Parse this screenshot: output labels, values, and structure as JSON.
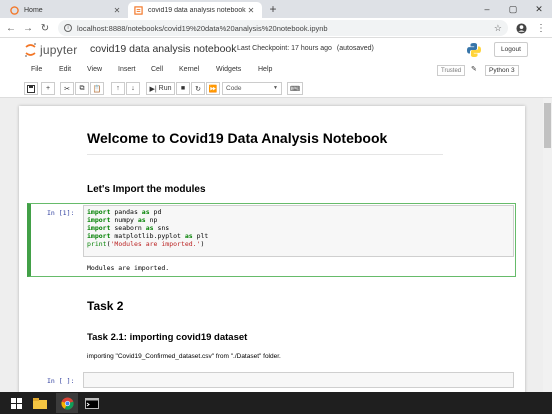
{
  "browser": {
    "tabs": [
      {
        "title": "Home",
        "active": false
      },
      {
        "title": "covid19 data analysis notebook",
        "active": true
      }
    ],
    "url": "localhost:8888/notebooks/covid19%20data%20analysis%20notebook.ipynb"
  },
  "jupyter": {
    "logo_text": "jupyter",
    "notebook_name": "covid19 data analysis notebook",
    "checkpoint": "Last Checkpoint: 17 hours ago",
    "save_status": "(autosaved)",
    "logout_label": "Logout",
    "menu": [
      "File",
      "Edit",
      "View",
      "Insert",
      "Cell",
      "Kernel",
      "Widgets",
      "Help"
    ],
    "trusted_label": "Trusted",
    "kernel_name": "Python 3",
    "run_label": "Run",
    "cell_type": "Code"
  },
  "notebook": {
    "title": "Welcome to Covid19 Data Analysis Notebook",
    "section1_heading": "Let's Import the modules",
    "cell1_prompt": "In [1]:",
    "cell1_lines": [
      [
        "import",
        " pandas ",
        "as",
        " pd"
      ],
      [
        "import",
        " numpy ",
        "as",
        " np"
      ],
      [
        "import",
        " seaborn ",
        "as",
        " sns"
      ],
      [
        "import",
        " matplotlib.pyplot ",
        "as",
        " plt"
      ]
    ],
    "cell1_print_fn": "print",
    "cell1_print_arg": "'Modules are imported.'",
    "cell1_output": "Modules are imported.",
    "task_heading": "Task 2",
    "task21_heading": "Task 2.1: importing covid19 dataset",
    "task21_text": "importing \"Covid19_Confirmed_dataset.csv\" from \"./Dataset\" folder.",
    "cell2_prompt": "In [ ]:"
  },
  "colors": {
    "selected_cell_border": "#42a047",
    "prompt_in": "#303f9f",
    "keyword": "#008000",
    "string": "#ba2121"
  }
}
